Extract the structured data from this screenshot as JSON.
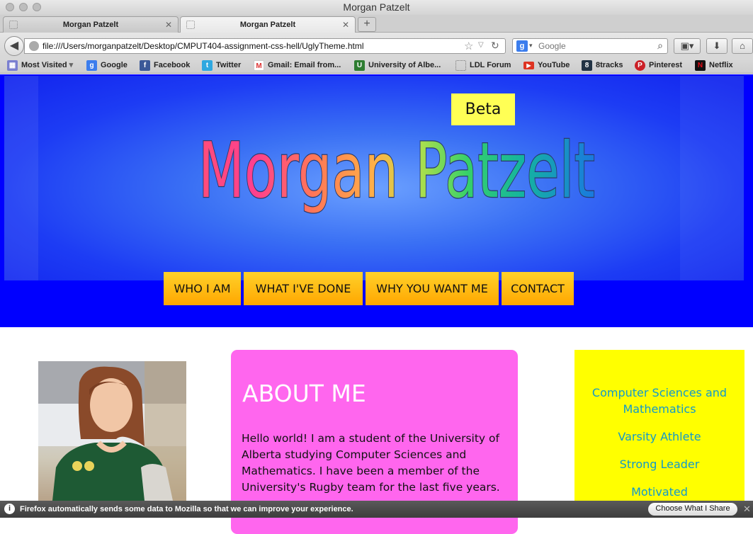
{
  "window": {
    "title": "Morgan Patzelt"
  },
  "tabs": [
    {
      "label": "Morgan Patzelt",
      "active": false
    },
    {
      "label": "Morgan Patzelt",
      "active": true
    }
  ],
  "toolbar": {
    "url": "file:///Users/morganpatzelt/Desktop/CMPUT404-assignment-css-hell/UglyTheme.html",
    "search_placeholder": "Google"
  },
  "bookmarks": [
    {
      "label": "Most Visited",
      "icon": "most-visited-icon"
    },
    {
      "label": "Google",
      "icon": "google-icon"
    },
    {
      "label": "Facebook",
      "icon": "facebook-icon"
    },
    {
      "label": "Twitter",
      "icon": "twitter-icon"
    },
    {
      "label": "Gmail: Email from...",
      "icon": "gmail-icon"
    },
    {
      "label": "University of Albe...",
      "icon": "ualberta-icon"
    },
    {
      "label": "LDL Forum",
      "icon": "page-icon"
    },
    {
      "label": "YouTube",
      "icon": "youtube-icon"
    },
    {
      "label": "8tracks",
      "icon": "8tracks-icon"
    },
    {
      "label": "Pinterest",
      "icon": "pinterest-icon"
    },
    {
      "label": "Netflix",
      "icon": "netflix-icon"
    }
  ],
  "page": {
    "beta_label": "Beta",
    "logo_text": "Morgan Patzelt",
    "nav": [
      "WHO I AM",
      "WHAT I'VE DONE",
      "WHY YOU WANT ME",
      "CONTACT"
    ],
    "about": {
      "heading": "ABOUT ME",
      "text": "Hello world! I am a student of the University of Alberta studying Computer Sciences and Mathematics. I have been a member of the University's Rugby team for the last five years."
    },
    "highlights": [
      "Computer Sciences and Mathematics",
      "Varsity Athlete",
      "Strong Leader",
      "Motivated"
    ]
  },
  "notification": {
    "message": "Firefox automatically sends some data to Mozilla so that we can improve your experience.",
    "button": "Choose What I Share"
  },
  "colors": {
    "header_blue": "#0000ff",
    "nav_orange": "#ffa600",
    "about_pink": "#ff66ee",
    "sidebar_yellow": "#ffff00",
    "highlight_text": "#1199cc",
    "beta_yellow": "#ffff55"
  }
}
